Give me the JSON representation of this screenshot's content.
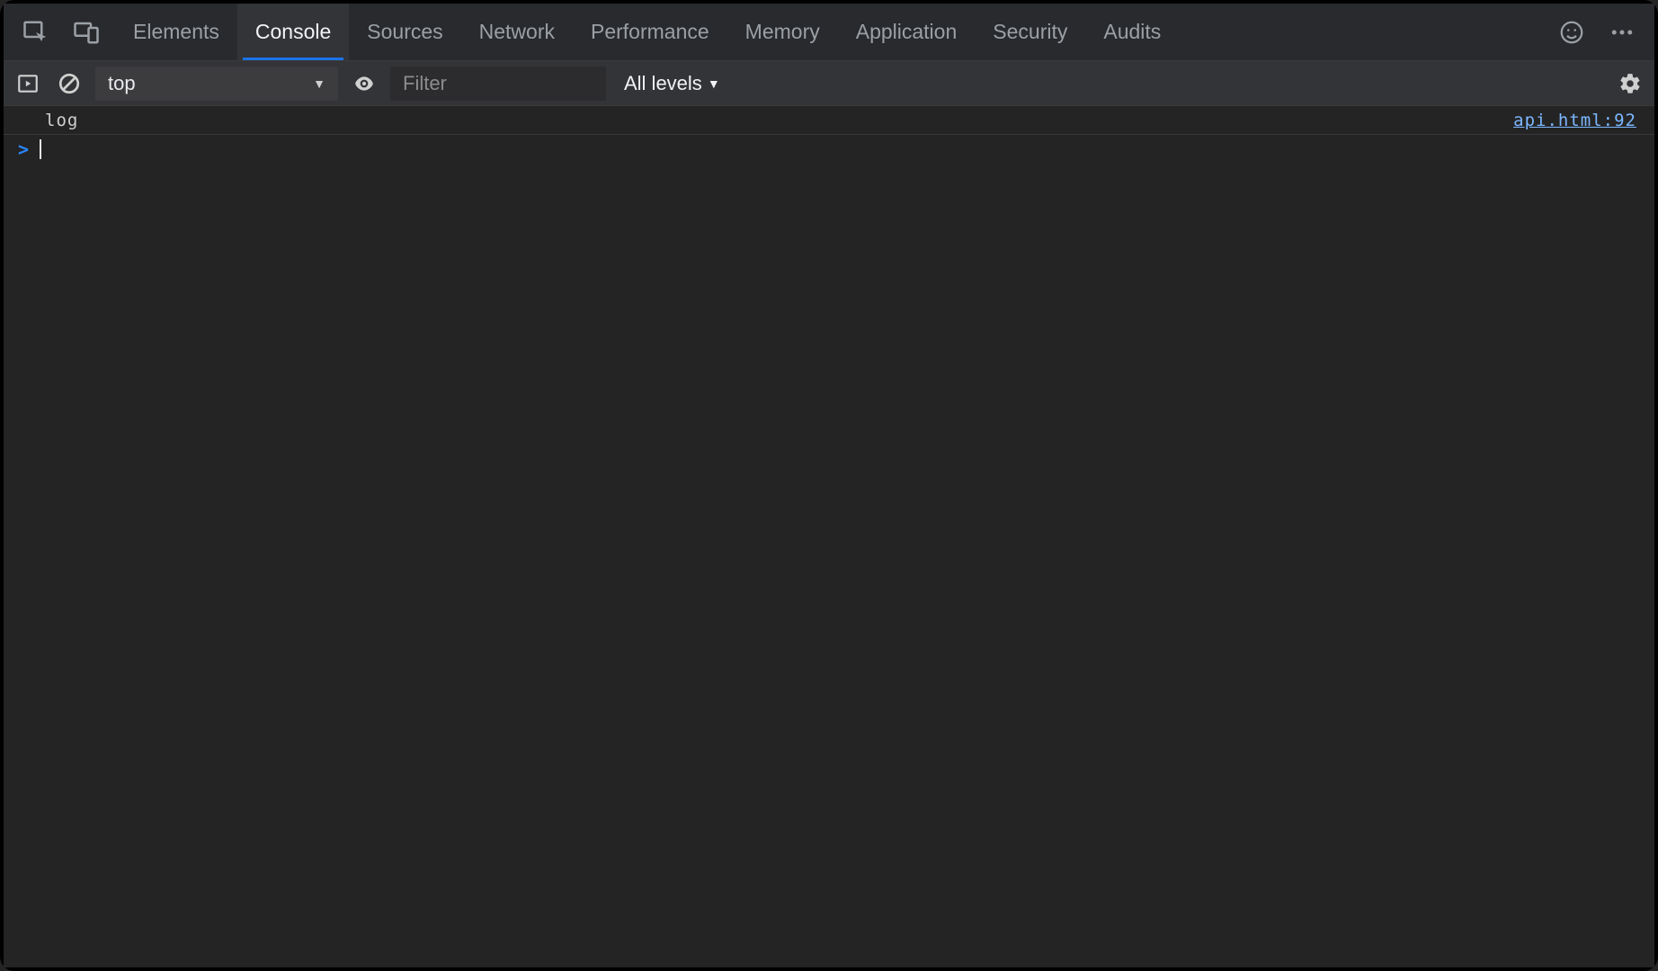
{
  "tabs": {
    "items": [
      {
        "label": "Elements"
      },
      {
        "label": "Console"
      },
      {
        "label": "Sources"
      },
      {
        "label": "Network"
      },
      {
        "label": "Performance"
      },
      {
        "label": "Memory"
      },
      {
        "label": "Application"
      },
      {
        "label": "Security"
      },
      {
        "label": "Audits"
      }
    ],
    "active_index": 1
  },
  "toolbar": {
    "context": "top",
    "filter_placeholder": "Filter",
    "levels_label": "All levels"
  },
  "logs": [
    {
      "message": "log",
      "source": "api.html:92"
    }
  ],
  "prompt": {
    "caret": ">"
  }
}
